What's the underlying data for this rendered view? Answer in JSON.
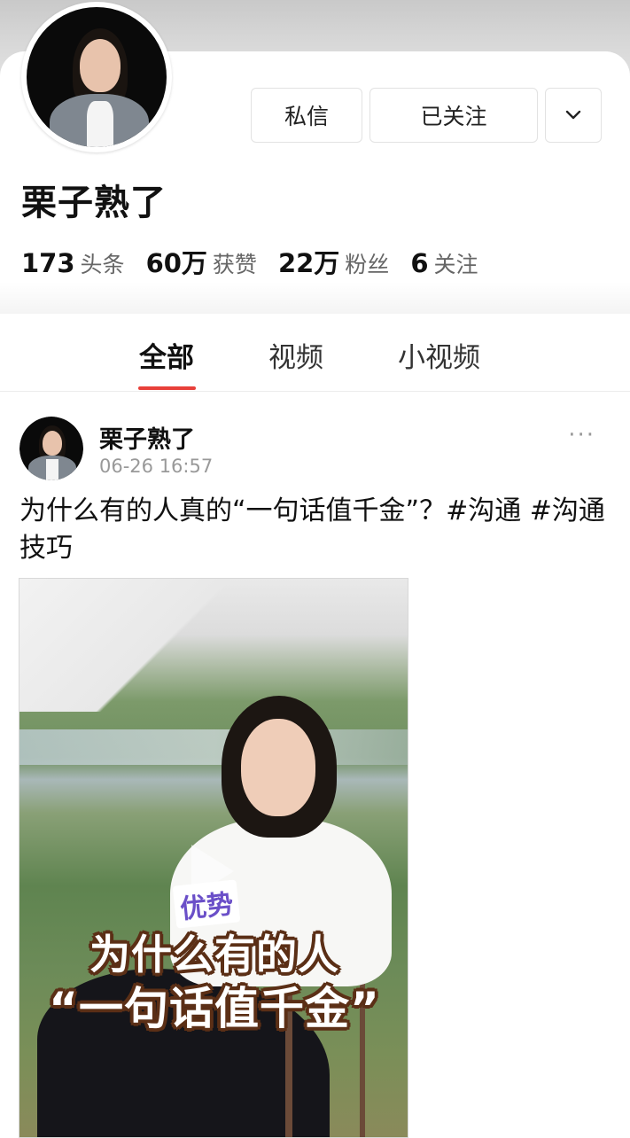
{
  "profile": {
    "name": "栗子熟了",
    "buttons": {
      "message": "私信",
      "following": "已关注",
      "more_icon": "chevron-down-icon"
    },
    "stats": [
      {
        "value": "173",
        "label": "头条"
      },
      {
        "value": "60万",
        "label": "获赞"
      },
      {
        "value": "22万",
        "label": "粉丝"
      },
      {
        "value": "6",
        "label": "关注"
      }
    ]
  },
  "tabs": {
    "items": [
      {
        "label": "全部",
        "active": true
      },
      {
        "label": "视频",
        "active": false
      },
      {
        "label": "小视频",
        "active": false
      }
    ],
    "accent_color": "#e8403a"
  },
  "post": {
    "author": "栗子熟了",
    "time": "06-26 16:57",
    "more": "···",
    "text": "为什么有的人真的“一句话值千金”？#沟通 #沟通技巧",
    "video": {
      "tag": "优势",
      "caption_line1": "为什么有的人",
      "caption_line2": "“一句话值千金”"
    }
  }
}
